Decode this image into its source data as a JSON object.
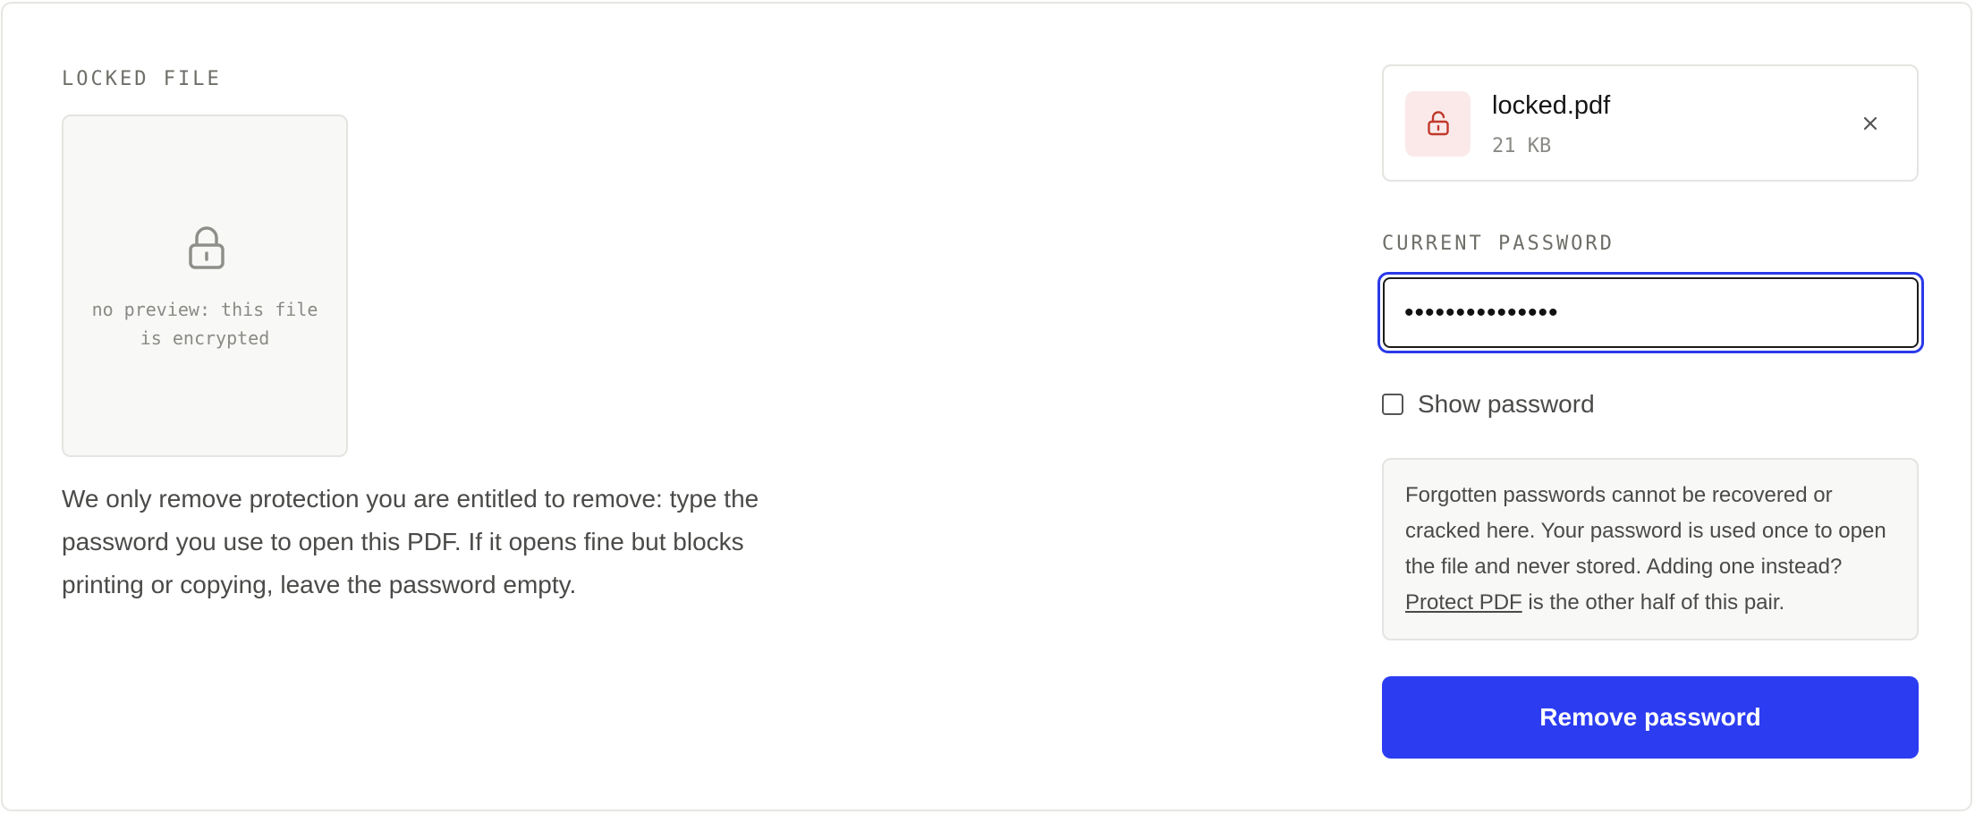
{
  "locked_file": {
    "section_label": "LOCKED FILE",
    "preview_icon": "lock-icon",
    "preview_message": "no preview: this file\nis encrypted"
  },
  "explanation": "We only remove protection you are entitled to remove: type the password you use to open this PDF. If it opens fine but blocks printing or copying, leave the password empty.",
  "file": {
    "icon": "unlocked-padlock-icon",
    "name": "locked.pdf",
    "size": "21 KB",
    "remove_icon": "close-icon"
  },
  "password": {
    "label": "CURRENT PASSWORD",
    "masked_value": "•••••••••••••••",
    "show_password_label": "Show password",
    "show_password_checked": false
  },
  "notice": {
    "text_before_link": "Forgotten passwords cannot be recovered or cracked here. Your password is used once to open the file and never stored. Adding one instead? ",
    "link_text": "Protect PDF",
    "text_after_link": " is the other half of this pair."
  },
  "actions": {
    "primary_label": "Remove password"
  },
  "colors": {
    "accent": "#2c3cf1",
    "focus_ring": "#2a3ae8",
    "file_icon_bg": "#fbe9e9",
    "file_icon_stroke": "#c0392b"
  }
}
